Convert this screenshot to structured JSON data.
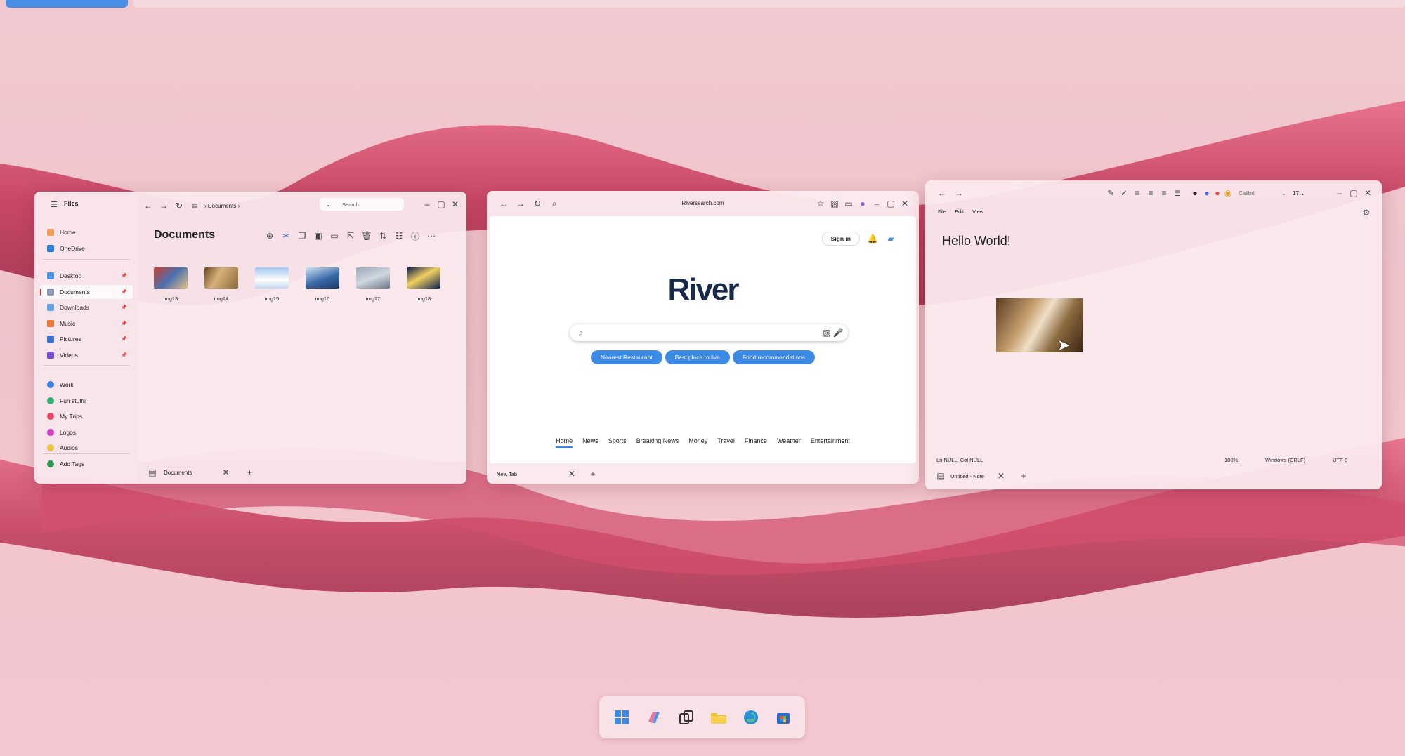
{
  "explorer": {
    "app_title": "Files",
    "path": "Documents",
    "search_placeholder": "Search",
    "heading": "Documents",
    "nav": [
      {
        "label": "Home",
        "color": "#f0a050"
      },
      {
        "label": "OneDrive",
        "color": "#2b7fd8"
      }
    ],
    "pinned": [
      {
        "label": "Desktop",
        "color": "#4a8fe6"
      },
      {
        "label": "Documents",
        "color": "#8a9ab8"
      },
      {
        "label": "Downloads",
        "color": "#5aa0e0"
      },
      {
        "label": "Music",
        "color": "#f07a3a"
      },
      {
        "label": "Pictures",
        "color": "#3a70d0"
      },
      {
        "label": "Videos",
        "color": "#7a4ad0"
      }
    ],
    "tags": [
      {
        "label": "Work",
        "color": "#3a80e8"
      },
      {
        "label": "Fun stuffs",
        "color": "#30b070"
      },
      {
        "label": "My Trips",
        "color": "#e84a6a"
      },
      {
        "label": "Logos",
        "color": "#d040c0"
      },
      {
        "label": "Audios",
        "color": "#f0c040"
      },
      {
        "label": "Add Tags",
        "color": "#2a9a50"
      }
    ],
    "files": [
      "img13",
      "img14",
      "img15",
      "img16",
      "img17",
      "img18"
    ],
    "tab_label": "Documents"
  },
  "browser": {
    "url": "Riversearch.com",
    "sign_in": "Sign in",
    "logo": "River",
    "chips": [
      "Nearest Restaurant",
      "Best place to live",
      "Food recommendations"
    ],
    "nav": [
      "Home",
      "News",
      "Sports",
      "Breaking News",
      "Money",
      "Travel",
      "Finance",
      "Weather",
      "Entertainment"
    ],
    "tab_label": "New Tab"
  },
  "notepad": {
    "menu": [
      "File",
      "Edit",
      "View"
    ],
    "font": "Calibri",
    "font_size": "17",
    "content": "Hello World!",
    "status": {
      "pos": "Ln NULL, Col NULL",
      "zoom": "100%",
      "eol": "Windows (CRLF)",
      "enc": "UTF-8"
    },
    "tab_label": "Untitled - Note"
  },
  "colors": {
    "accent": "#3b8ae6",
    "background": "#f2c7cf"
  }
}
